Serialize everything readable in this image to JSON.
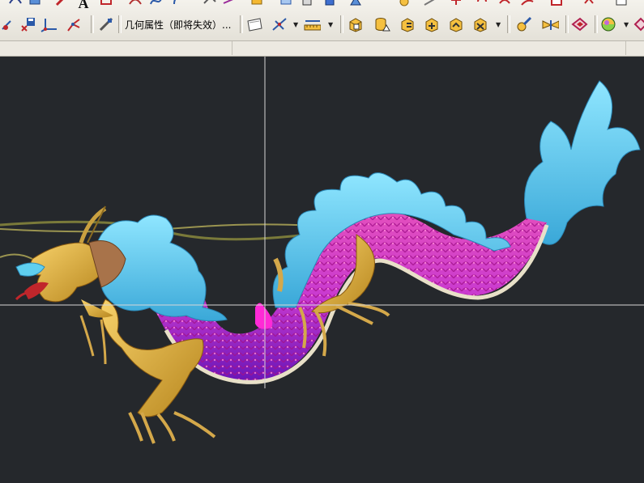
{
  "toolbar": {
    "geometry_properties_label": "几何属性（即将失效）...",
    "top_row_letter": "A"
  },
  "icons": [
    "hide-tool-icon",
    "save-view-icon",
    "wcs-axis-icon",
    "wcs-origin-icon",
    "move-tool-icon",
    "select-filter-icon",
    "ruler-icon",
    "box-solid-icon",
    "cylinder-solid-icon",
    "cone-solid-icon",
    "sphere-solid-icon",
    "unite-solid-icon",
    "subtract-solid-icon",
    "intersect-solid-icon",
    "analysis-icon",
    "render-icon",
    "shade-icon",
    "display-mode-icon",
    "texture-icon"
  ],
  "colors": {
    "viewport_background": "#25282c",
    "dragon_body": "#d42fb3",
    "dragon_scales": "#8a2bd6",
    "dragon_mane": "#5fcfef",
    "dragon_limbs": "#e2b64a",
    "crosshair": "#d6d6d6",
    "selection_highlight": "#ff2ad6"
  }
}
